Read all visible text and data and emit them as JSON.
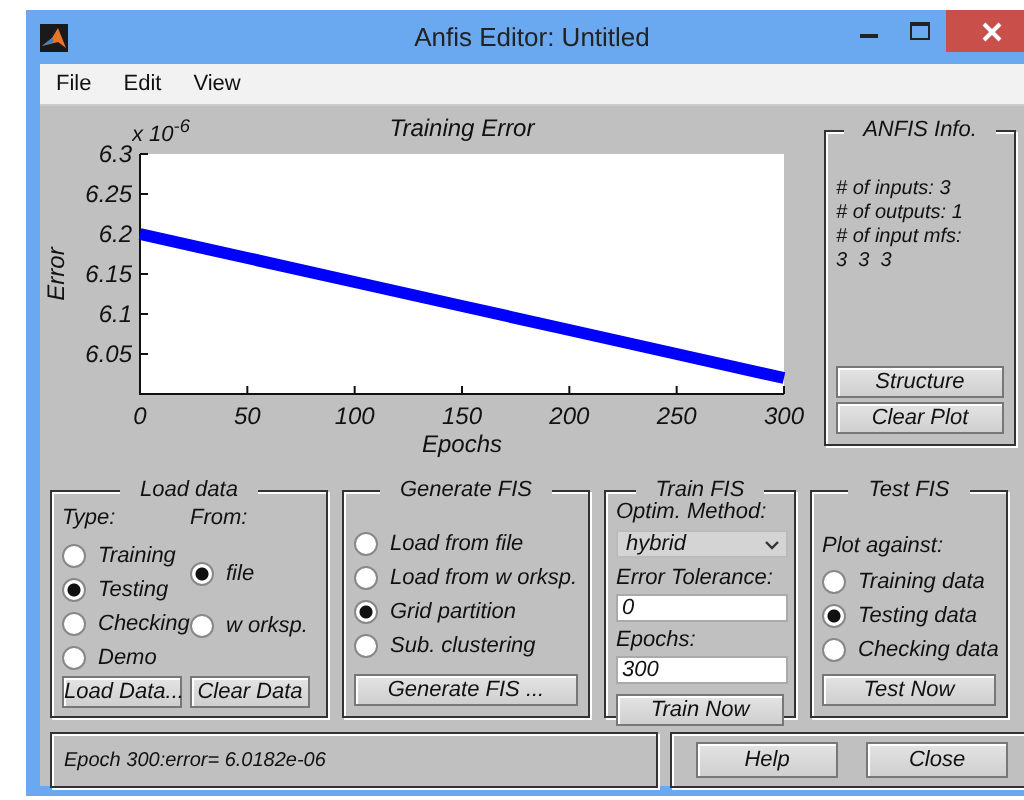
{
  "window": {
    "title": "Anfis Editor: Untitled"
  },
  "menu": [
    "File",
    "Edit",
    "View"
  ],
  "plot": {
    "chart_data": {
      "type": "line",
      "title": "Training Error",
      "xlabel": "Epochs",
      "ylabel": "Error",
      "x": [
        0,
        50,
        100,
        150,
        200,
        250,
        300
      ],
      "series": [
        {
          "color": "#0000ff",
          "values": [
            6.2,
            6.17,
            6.14,
            6.11,
            6.08,
            6.05,
            6.02
          ]
        }
      ],
      "xlim": [
        0,
        300
      ],
      "ylim": [
        6.0,
        6.3
      ],
      "xticks": [
        0,
        50,
        100,
        150,
        200,
        250,
        300
      ],
      "yticks": [
        6.05,
        6.1,
        6.15,
        6.2,
        6.25,
        6.3
      ],
      "annotations": [
        "x 10$^{-6}$"
      ]
    }
  },
  "anfis_info": {
    "title": "ANFIS Info.",
    "lines": [
      "# of inputs: 3",
      "# of outputs: 1",
      "# of input mfs:",
      "3  3  3"
    ],
    "buttons": [
      "Structure",
      "Clear Plot"
    ]
  },
  "load_data": {
    "title": "Load data",
    "type_label": "Type:",
    "from_label": "From:",
    "types": [
      {
        "label": "Training",
        "selected": false
      },
      {
        "label": "Testing",
        "selected": true
      },
      {
        "label": "Checking",
        "selected": false
      },
      {
        "label": "Demo",
        "selected": false
      }
    ],
    "sources": [
      {
        "label": "file",
        "selected": true
      },
      {
        "label": "w orksp.",
        "selected": false
      }
    ],
    "buttons": [
      "Load Data...",
      "Clear Data"
    ]
  },
  "generate_fis": {
    "title": "Generate FIS",
    "options": [
      {
        "label": "Load from file",
        "selected": false
      },
      {
        "label": "Load from w orksp.",
        "selected": false
      },
      {
        "label": "Grid partition",
        "selected": true
      },
      {
        "label": "Sub. clustering",
        "selected": false
      }
    ],
    "button": "Generate FIS ..."
  },
  "train_fis": {
    "title": "Train FIS",
    "method_label": "Optim. Method:",
    "method": "hybrid",
    "tolerance_label": "Error Tolerance:",
    "tolerance": "0",
    "epochs_label": "Epochs:",
    "epochs": "300",
    "button": "Train Now"
  },
  "test_fis": {
    "title": "Test FIS",
    "plot_against_label": "Plot against:",
    "options": [
      {
        "label": "Training data",
        "selected": false
      },
      {
        "label": "Testing data",
        "selected": true
      },
      {
        "label": "Checking data",
        "selected": false
      }
    ],
    "button": "Test Now"
  },
  "status": {
    "message": "Epoch 300:error= 6.0182e-06"
  },
  "buttons": [
    "Help",
    "Close"
  ]
}
